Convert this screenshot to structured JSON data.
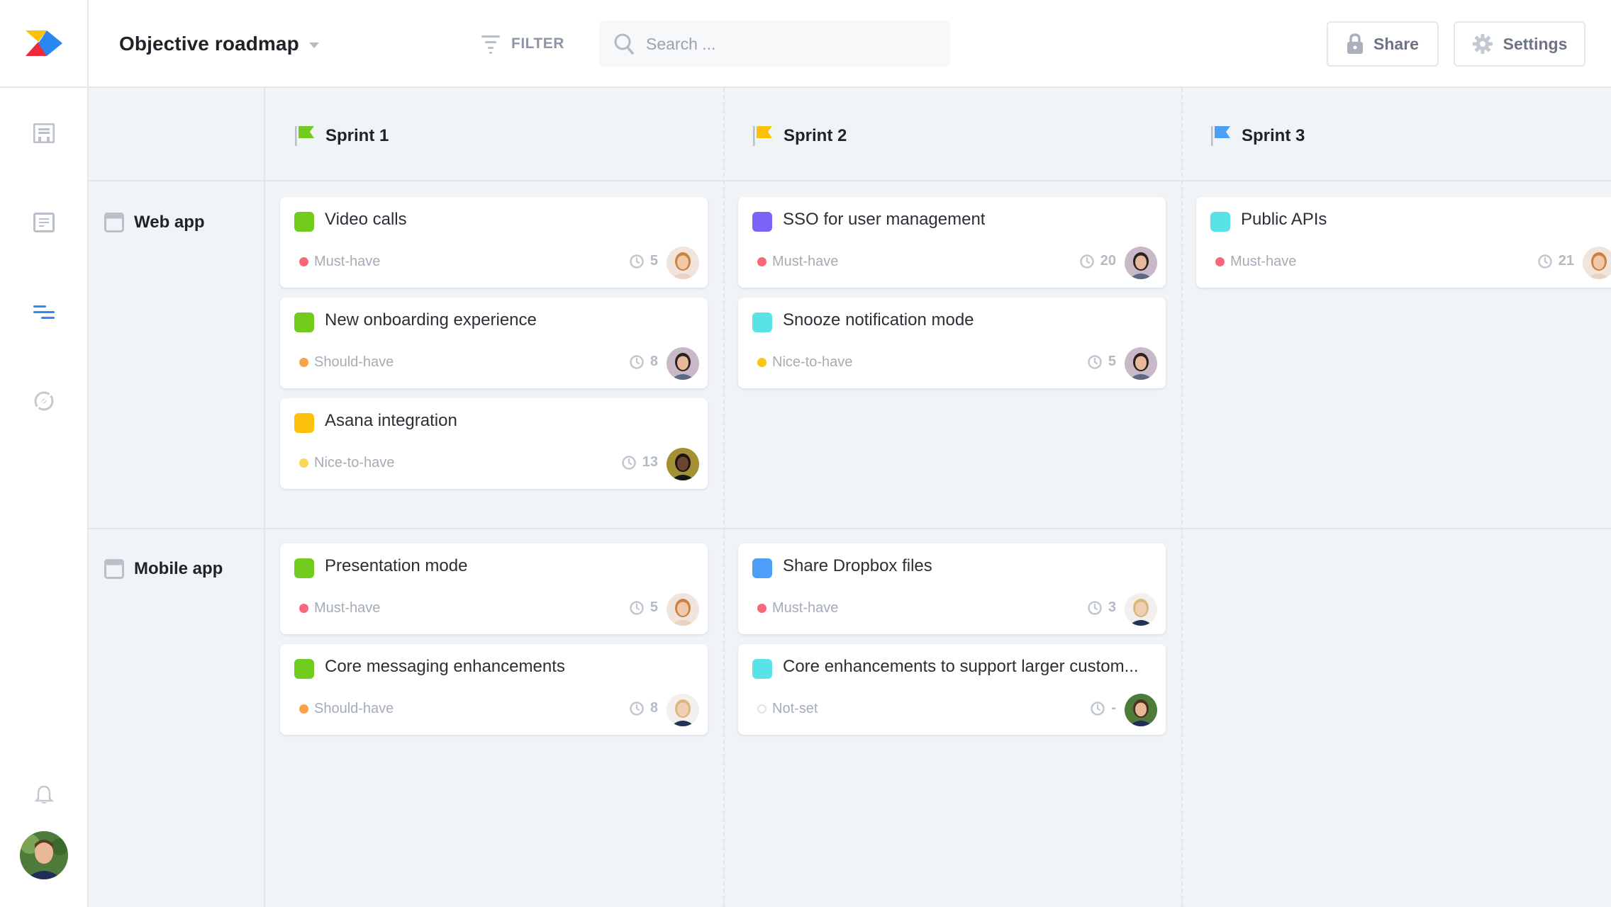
{
  "app": {
    "logo": "app-logo",
    "title": "Objective roadmap"
  },
  "header": {
    "filter_label": "FILTER",
    "search_placeholder": "Search ...",
    "search_value": "",
    "share_label": "Share",
    "settings_label": "Settings"
  },
  "sidebar": {
    "items": [
      {
        "icon": "board-icon",
        "active": false
      },
      {
        "icon": "document-icon",
        "active": false
      },
      {
        "icon": "roadmap-icon",
        "active": true
      },
      {
        "icon": "compass-icon",
        "active": false
      }
    ],
    "bottom": {
      "icon": "bell-icon",
      "avatar": "user-avatar"
    }
  },
  "colors": {
    "accent": "#2a8cf0",
    "must_have": "#f7687a",
    "should_have": "#f9a04b",
    "nice_to_have": "#fbc513",
    "green": "#72cc1e",
    "yellow": "#fcc10a",
    "purple": "#7d62f7",
    "cyan": "#5ae3e6",
    "blue": "#4c9ef9"
  },
  "sprints": [
    {
      "name": "Sprint 1",
      "flag_color": "#72cc1e"
    },
    {
      "name": "Sprint 2",
      "flag_color": "#fcc10a"
    },
    {
      "name": "Sprint 3",
      "flag_color": "#4c9ef9"
    }
  ],
  "rows": [
    {
      "label": "Web app",
      "columns": [
        [
          {
            "title": "Video calls",
            "color": "#72cc1e",
            "priority": "Must-have",
            "priority_color": "#f7687a",
            "effort": "5",
            "avatar": "avatar-redhead"
          },
          {
            "title": "New onboarding experience",
            "color": "#72cc1e",
            "priority": "Should-have",
            "priority_color": "#f9a04b",
            "effort": "8",
            "avatar": "avatar-man-dark"
          },
          {
            "title": "Asana integration",
            "color": "#fcc10a",
            "priority": "Nice-to-have",
            "priority_color": "#fcd55a",
            "effort": "13",
            "avatar": "avatar-woman-dark"
          }
        ],
        [
          {
            "title": "SSO for user management",
            "color": "#7d62f7",
            "priority": "Must-have",
            "priority_color": "#f7687a",
            "effort": "20",
            "avatar": "avatar-man-dark"
          },
          {
            "title": "Snooze notification mode",
            "color": "#5ae3e6",
            "priority": "Nice-to-have",
            "priority_color": "#fbc513",
            "effort": "5",
            "avatar": "avatar-man-dark"
          }
        ],
        [
          {
            "title": "Public APIs",
            "color": "#5ae3e6",
            "priority": "Must-have",
            "priority_color": "#f7687a",
            "effort": "21",
            "avatar": "avatar-redhead"
          }
        ]
      ]
    },
    {
      "label": "Mobile app",
      "columns": [
        [
          {
            "title": "Presentation mode",
            "color": "#72cc1e",
            "priority": "Must-have",
            "priority_color": "#f7687a",
            "effort": "5",
            "avatar": "avatar-redhead"
          },
          {
            "title": "Core messaging enhancements",
            "color": "#72cc1e",
            "priority": "Should-have",
            "priority_color": "#f9a04b",
            "effort": "8",
            "avatar": "avatar-blonde"
          }
        ],
        [
          {
            "title": "Share Dropbox files",
            "color": "#4c9ef9",
            "priority": "Must-have",
            "priority_color": "#f7687a",
            "effort": "3",
            "avatar": "avatar-blonde"
          },
          {
            "title": "Core enhancements to support larger custom...",
            "color": "#5ae3e6",
            "priority": "Not-set",
            "priority_color": "",
            "effort": "-",
            "avatar": "avatar-man-smiling"
          }
        ],
        []
      ]
    }
  ]
}
